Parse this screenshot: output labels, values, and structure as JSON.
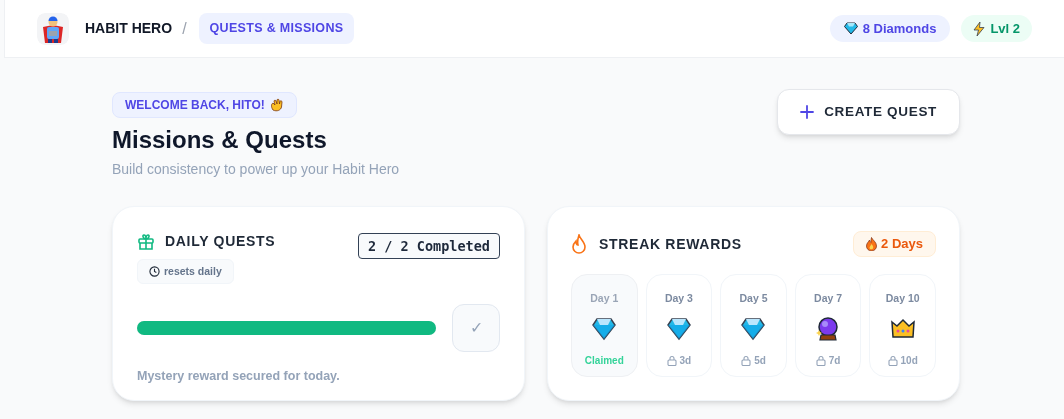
{
  "header": {
    "app_name": "HABIT HERO",
    "separator": "/",
    "breadcrumb": "QUESTS & MISSIONS",
    "diamonds": "8 Diamonds",
    "level": "Lvl 2"
  },
  "hero": {
    "badge": "WELCOME BACK, HITO!",
    "title": "Missions & Quests",
    "subtitle": "Build consistency to power up your Habit Hero",
    "button": "CREATE QUEST"
  },
  "daily_quests": {
    "title": "DAILY QUESTS",
    "status": "2 / 2 Completed",
    "reset_note": "resets daily",
    "progress": {
      "level": 1.0
    },
    "check_button": "✓",
    "message": "Mystery reward secured for today."
  },
  "streak_rewards": {
    "title": "STREAK REWARDS",
    "streak": "2 Days",
    "rewards": [
      {
        "day": "Day 1",
        "kind": "diamond",
        "claimed": true,
        "status": "Claimed"
      },
      {
        "day": "Day 3",
        "kind": "diamond",
        "claimed": false,
        "status": "3d"
      },
      {
        "day": "Day 5",
        "kind": "diamond",
        "claimed": false,
        "status": "5d"
      },
      {
        "day": "Day 7",
        "kind": "orb",
        "claimed": false,
        "status": "7d"
      },
      {
        "day": "Day 10",
        "kind": "crown",
        "claimed": false,
        "status": "10d"
      }
    ]
  }
}
